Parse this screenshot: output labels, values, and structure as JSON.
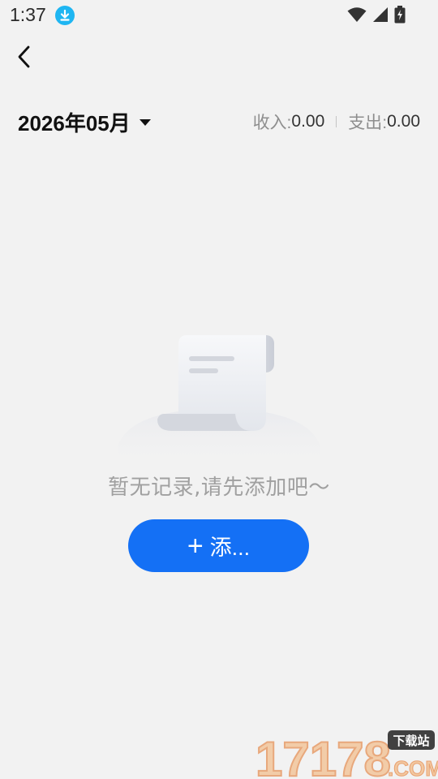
{
  "status_bar": {
    "time": "1:37"
  },
  "header": {
    "month": "2026年05月",
    "income_label": "收入:",
    "income_value": "0.00",
    "expense_label": "支出:",
    "expense_value": "0.00"
  },
  "empty_state": {
    "message": "暂无记录,请先添加吧～",
    "add_button_label": "添..."
  },
  "watermark": {
    "number": "17178",
    "tag": "下载站",
    "suffix": ".COM"
  },
  "colors": {
    "background": "#f2f2f2",
    "accent": "#1470f5",
    "status_download": "#1fb6f2"
  }
}
